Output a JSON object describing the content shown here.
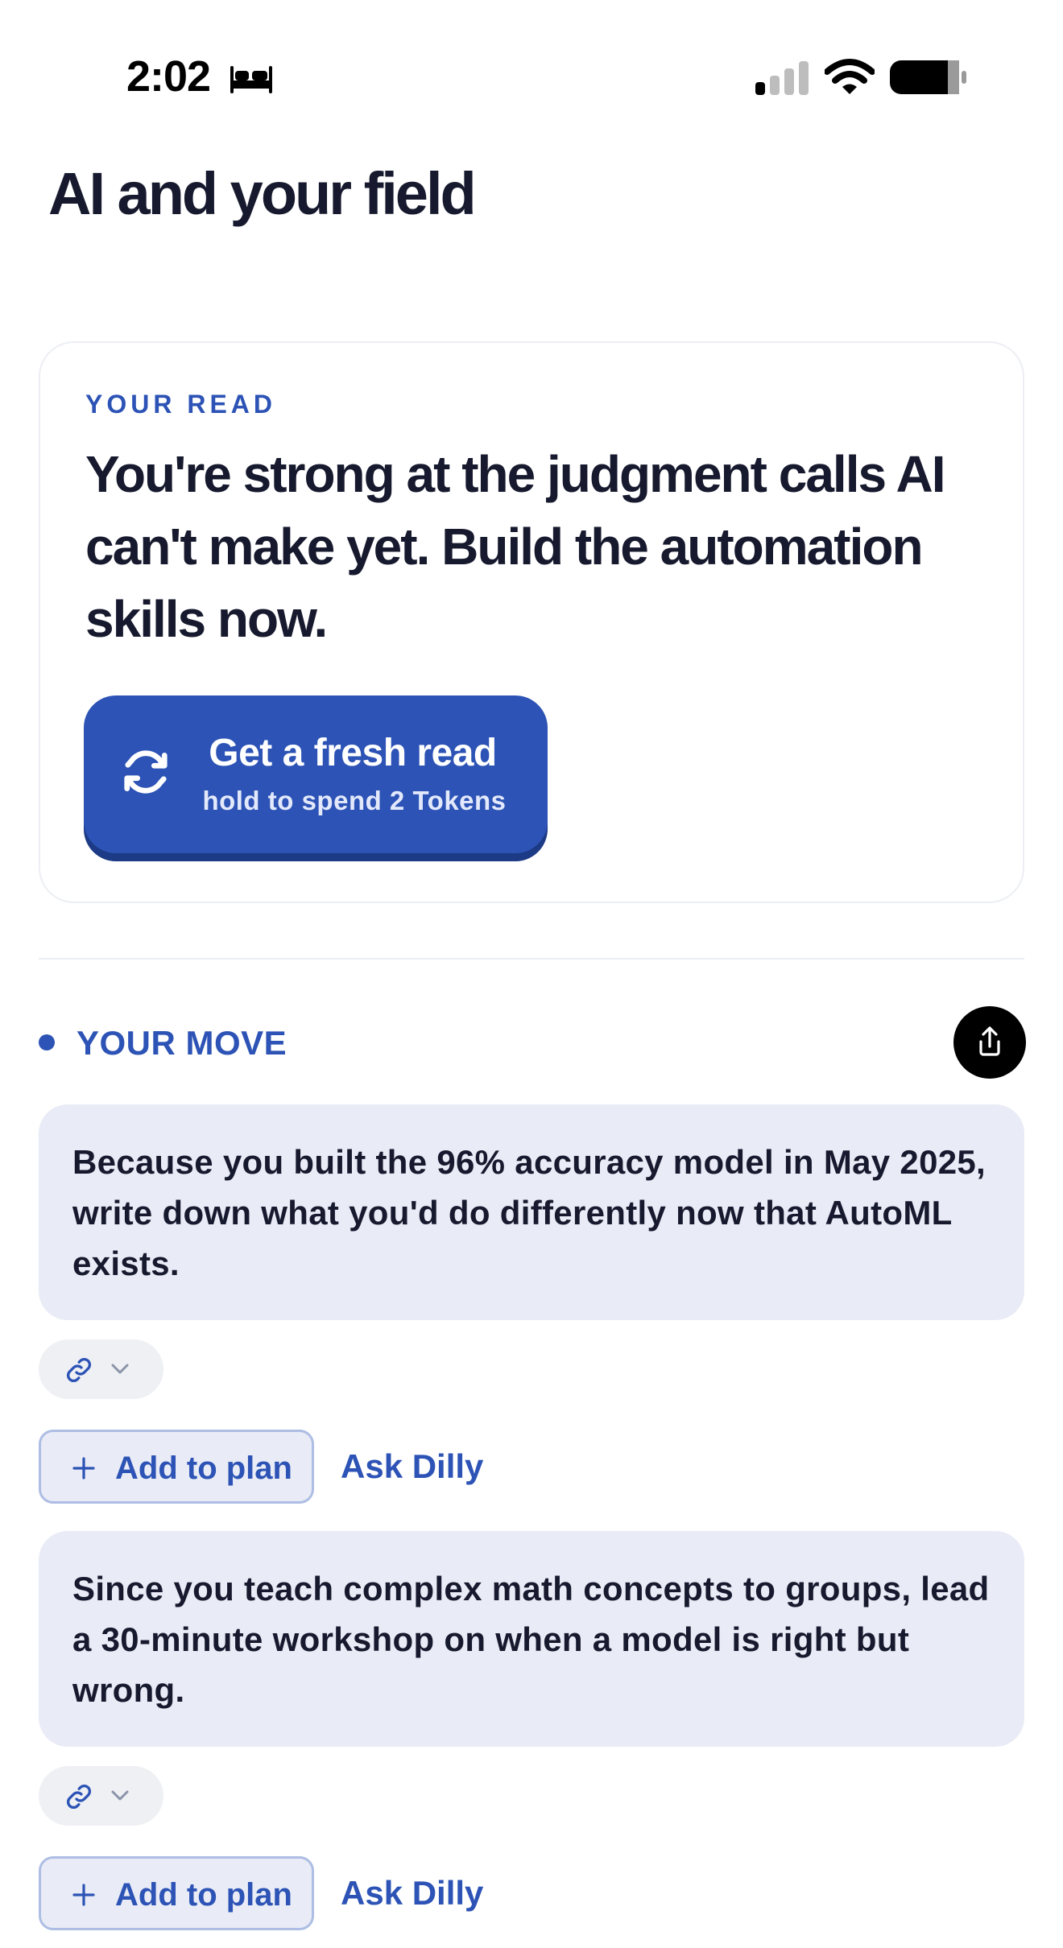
{
  "status_bar": {
    "time": "2:02",
    "focus_icon": "bed-icon",
    "signal_icon": "cellular-signal-icon",
    "wifi_icon": "wifi-icon",
    "battery_icon": "battery-icon"
  },
  "page": {
    "title": "AI and your field"
  },
  "read_card": {
    "eyebrow": "YOUR READ",
    "headline": "You're strong at the judgment calls AI can't make yet. Build the automation skills now.",
    "button": {
      "icon": "refresh-icon",
      "title": "Get a fresh read",
      "subtitle": "hold to spend 2 Tokens"
    }
  },
  "moves": {
    "label": "YOUR MOVE",
    "share_icon": "share-icon",
    "items": [
      {
        "text": "Because you built the 96% accuracy model in May 2025, write down what you'd do differently now that AutoML exists.",
        "add_label": "Add to plan",
        "ask_label": "Ask Dilly"
      },
      {
        "text": "Since you teach complex math concepts to groups, lead a 30-minute workshop on when a model is right but wrong.",
        "add_label": "Add to plan",
        "ask_label": "Ask Dilly"
      }
    ]
  },
  "colors": {
    "accent": "#2c53b5",
    "accent_shadow": "#1c3a85",
    "ink": "#171a2e",
    "move_bg": "#e9ecf6",
    "card_border": "#eceef3"
  }
}
